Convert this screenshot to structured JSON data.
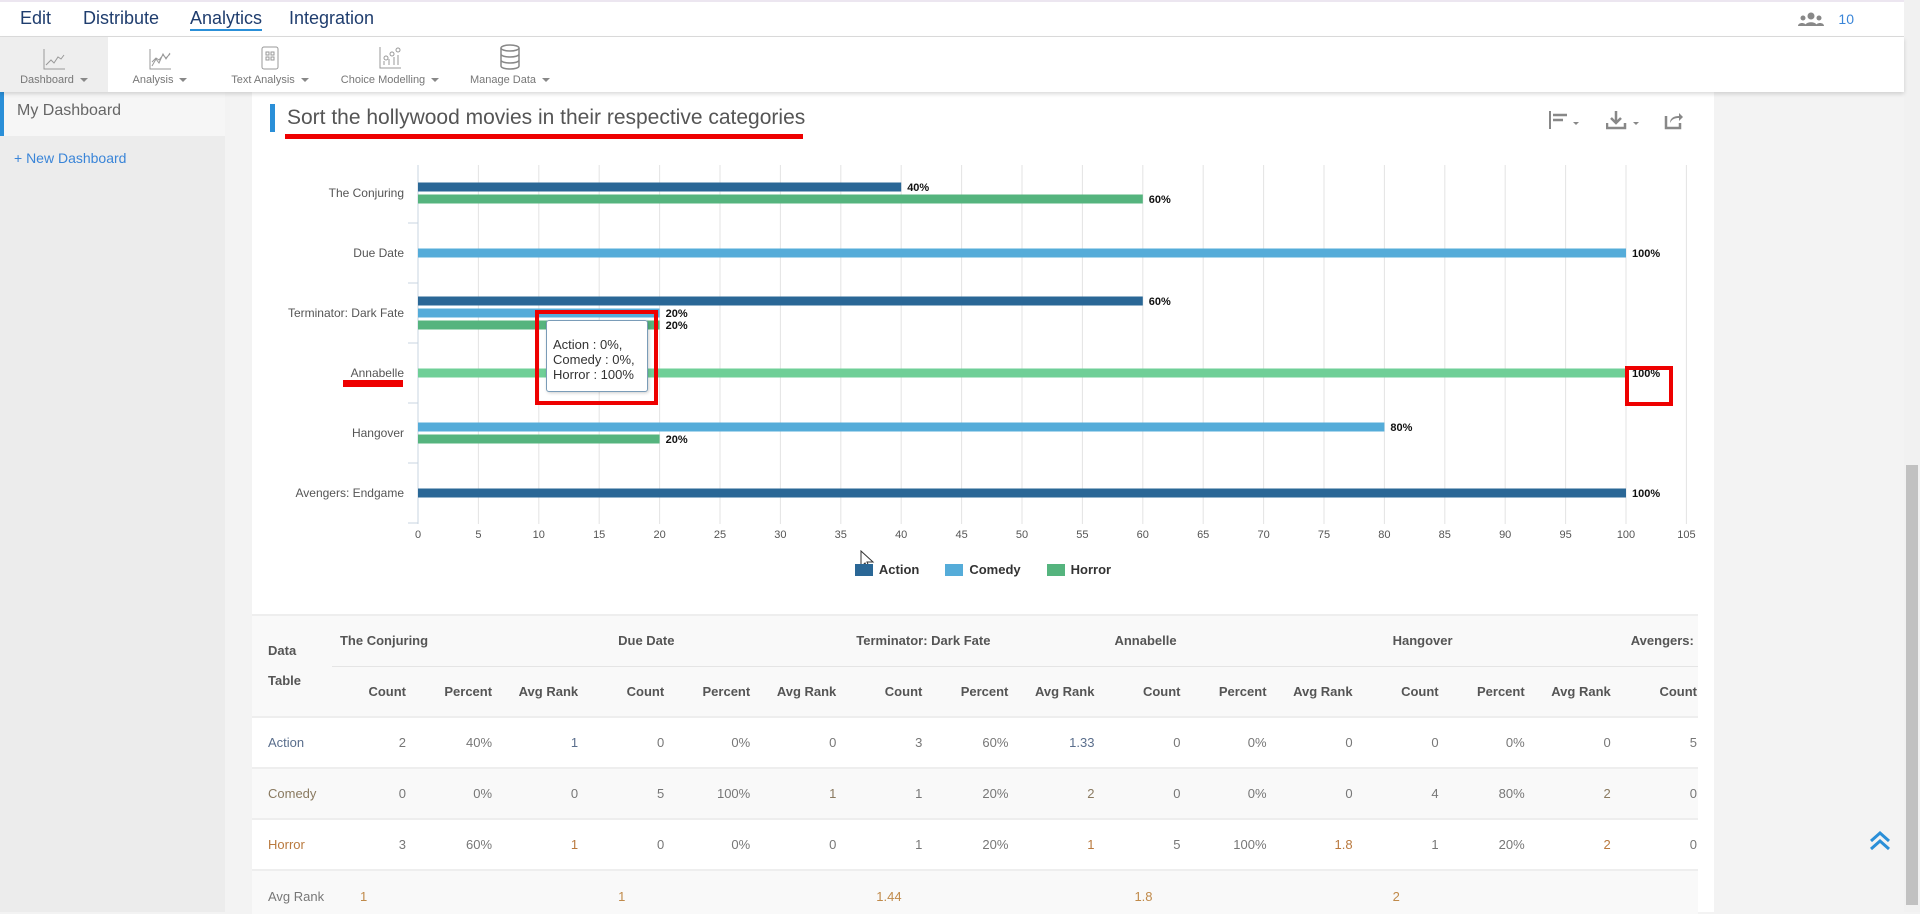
{
  "nav": {
    "items": [
      "Edit",
      "Distribute",
      "Analytics",
      "Integration"
    ],
    "active": "Analytics",
    "user_count": "10"
  },
  "toolbar": [
    {
      "label": "Dashboard",
      "icon": "line-chart-icon"
    },
    {
      "label": "Analysis",
      "icon": "analysis-chart-icon"
    },
    {
      "label": "Text Analysis",
      "icon": "text-analysis-icon"
    },
    {
      "label": "Choice Modelling",
      "icon": "choice-modelling-icon"
    },
    {
      "label": "Manage Data",
      "icon": "database-icon"
    }
  ],
  "sidebar": {
    "my_dashboard": "My Dashboard",
    "new_dashboard": "+ New Dashboard"
  },
  "panel": {
    "title": "Sort the hollywood movies in their respective categories"
  },
  "tooltip": {
    "lines": [
      "Action : 0%,",
      "Comedy : 0%,",
      "Horror : 100%"
    ]
  },
  "colors": {
    "Action": "#2a6796",
    "Comedy": "#55acd9",
    "Horror": "#55b47e",
    "accent": "#2a8fd8",
    "annotation": "#e00000"
  },
  "chart_data": {
    "type": "bar",
    "orientation": "horizontal",
    "categories": [
      "The Conjuring",
      "Due Date",
      "Terminator: Dark Fate",
      "Annabelle",
      "Hangover",
      "Avengers: Endgame"
    ],
    "series": [
      {
        "name": "Action",
        "values": [
          40,
          0,
          60,
          0,
          0,
          100
        ]
      },
      {
        "name": "Comedy",
        "values": [
          0,
          100,
          20,
          0,
          80,
          0
        ]
      },
      {
        "name": "Horror",
        "values": [
          60,
          0,
          20,
          100,
          20,
          0
        ]
      }
    ],
    "xlim": [
      0,
      105
    ],
    "xticks": [
      0,
      5,
      10,
      15,
      20,
      25,
      30,
      35,
      40,
      45,
      50,
      55,
      60,
      65,
      70,
      75,
      80,
      85,
      90,
      95,
      100,
      105
    ],
    "grid": true,
    "legend": "bottom-center",
    "data_label_suffix": "%"
  },
  "table": {
    "corner": "Data Table",
    "groups": [
      "The Conjuring",
      "Due Date",
      "Terminator: Dark Fate",
      "Annabelle",
      "Hangover",
      "Avengers: Endgame"
    ],
    "subheaders": [
      "Count",
      "Percent",
      "Avg Rank"
    ],
    "rows": [
      {
        "label": "Action",
        "cells": [
          "2",
          "40%",
          "1",
          "0",
          "0%",
          "0",
          "3",
          "60%",
          "1.33",
          "0",
          "0%",
          "0",
          "0",
          "0%",
          "0",
          "5"
        ]
      },
      {
        "label": "Comedy",
        "cells": [
          "0",
          "0%",
          "0",
          "5",
          "100%",
          "1",
          "1",
          "20%",
          "2",
          "0",
          "0%",
          "0",
          "4",
          "80%",
          "2",
          "0"
        ]
      },
      {
        "label": "Horror",
        "cells": [
          "3",
          "60%",
          "1",
          "0",
          "0%",
          "0",
          "1",
          "20%",
          "1",
          "5",
          "100%",
          "1.8",
          "1",
          "20%",
          "2",
          "0"
        ]
      }
    ],
    "avg_rank": {
      "label": "Avg Rank",
      "values": [
        "1",
        "1",
        "1.44",
        "1.8",
        "2"
      ]
    }
  }
}
